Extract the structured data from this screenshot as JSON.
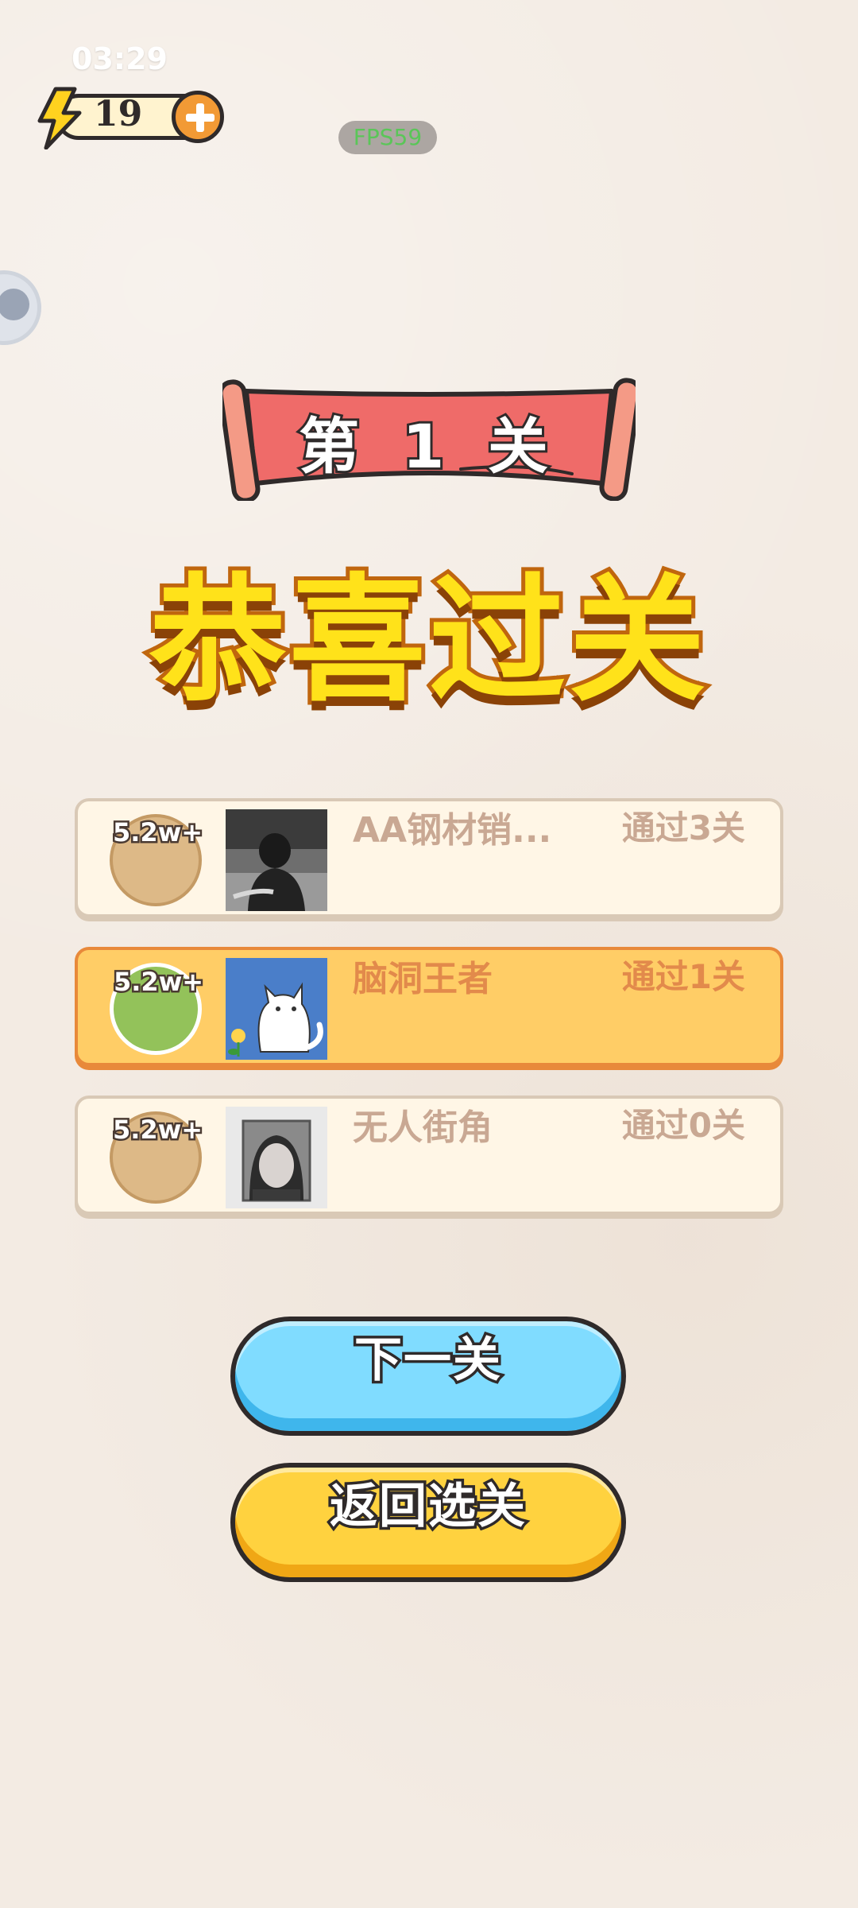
{
  "status_bar": {
    "time": "03:29"
  },
  "energy": {
    "count": "19",
    "bolt_icon": "lightning-icon",
    "add_icon": "plus-icon"
  },
  "debug": {
    "fps": "FPS59"
  },
  "banner": {
    "level_label": "第 1 关"
  },
  "result": {
    "title": "恭喜过关"
  },
  "leaderboard": {
    "rows": [
      {
        "score": "5.2w+",
        "name": "AA钢材销...",
        "progress": "通过3关",
        "highlight": false
      },
      {
        "score": "5.2w+",
        "name": "脑洞王者",
        "progress": "通过1关",
        "highlight": true
      },
      {
        "score": "5.2w+",
        "name": "无人街角",
        "progress": "通过0关",
        "highlight": false
      }
    ]
  },
  "buttons": {
    "next_label": "下一关",
    "back_label": "返回选关"
  },
  "colors": {
    "background": "#f3ebe3",
    "banner_red": "#ef6b69",
    "title_yellow": "#ffe21a",
    "next_button": "#80dcff",
    "back_button": "#ffd23f",
    "highlight_row": "#ffcd66"
  }
}
